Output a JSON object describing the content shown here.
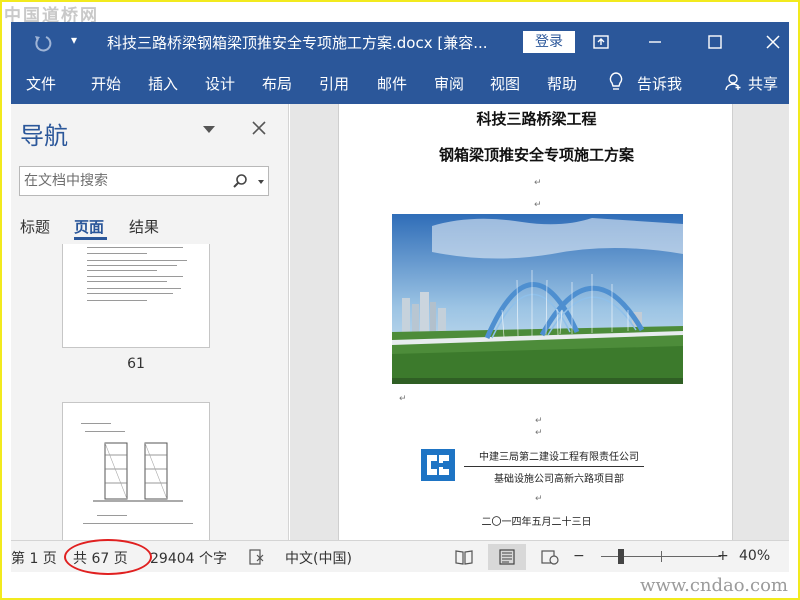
{
  "watermarks": {
    "top": "中国道桥网",
    "bottom": "www.cndao.com"
  },
  "titlebar": {
    "document_title": "科技三路桥梁钢箱梁顶推安全专项施工方案.docx [兼容...",
    "login_label": "登录",
    "icons": [
      "undo-icon",
      "qat-dropdown-icon",
      "ribbon-display-icon",
      "minimize-icon",
      "maximize-icon",
      "close-icon"
    ]
  },
  "ribbon": {
    "tabs": [
      "文件",
      "开始",
      "插入",
      "设计",
      "布局",
      "引用",
      "邮件",
      "审阅",
      "视图",
      "帮助"
    ],
    "tell_me": "告诉我",
    "share": "共享"
  },
  "nav": {
    "title": "导航",
    "search_placeholder": "在文档中搜索",
    "tabs": [
      "标题",
      "页面",
      "结果"
    ],
    "active_tab": "页面",
    "thumbnails": [
      {
        "page_label": "61"
      }
    ]
  },
  "document": {
    "title_line1": "科技三路桥梁工程",
    "title_line2": "钢箱梁顶推安全专项施工方案",
    "company": "中建三局第二建设工程有限责任公司",
    "department": "基础设施公司高新六路项目部",
    "date": "二〇一四年五月二十三日",
    "paragraph_mark": "↵",
    "logo_text": "CSCEC"
  },
  "statusbar": {
    "page_indicator": "第 1 页",
    "total_pages": "共 67 页",
    "word_count": "29404 个字",
    "language": "中文(中国)",
    "zoom_level": "40%",
    "zoom_minus": "−",
    "zoom_plus": "+",
    "zoom_fraction": 0.4
  },
  "colors": {
    "ribbon_blue": "#2b579a",
    "highlight_circle": "#e02020",
    "frame_yellow": "#f2ea1e"
  }
}
